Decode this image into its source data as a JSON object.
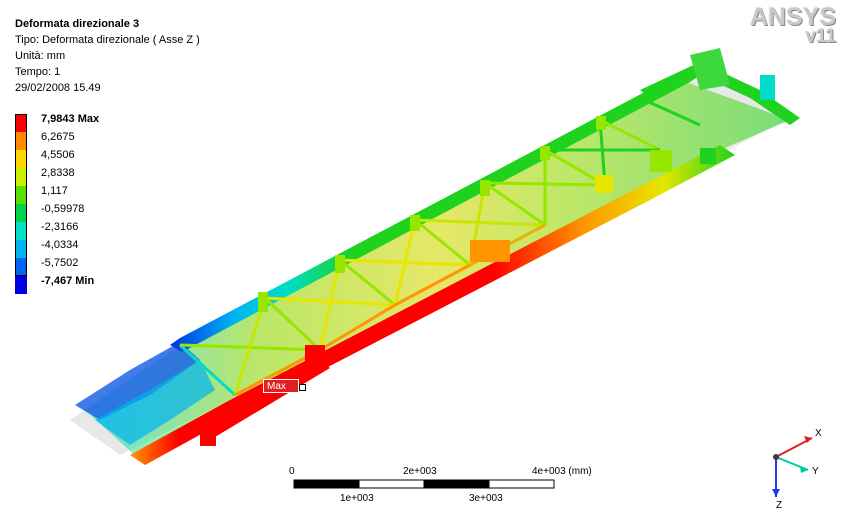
{
  "result": {
    "title": "Deformata direzionale 3",
    "type": "Tipo: Deformata direzionale ( Asse Z )",
    "unit": "Unità: mm",
    "time": "Tempo: 1",
    "date": "29/02/2008 15.49"
  },
  "legend": [
    {
      "label": "7,9843 Max",
      "color": "#ff0000",
      "bold": true
    },
    {
      "label": "6,2675",
      "color": "#ff8c00",
      "bold": false
    },
    {
      "label": "4,5506",
      "color": "#ffd700",
      "bold": false
    },
    {
      "label": "2,8338",
      "color": "#c8f000",
      "bold": false
    },
    {
      "label": "1,117",
      "color": "#5ae000",
      "bold": false
    },
    {
      "label": "-0,59978",
      "color": "#00d24a",
      "bold": false
    },
    {
      "label": "-2,3166",
      "color": "#00e2c8",
      "bold": false
    },
    {
      "label": "-4,0334",
      "color": "#00b4f0",
      "bold": false
    },
    {
      "label": "-5,7502",
      "color": "#0064f5",
      "bold": false
    },
    {
      "label": "-7,467 Min",
      "color": "#0000e0",
      "bold": true
    }
  ],
  "logo": {
    "name": "ANSYS",
    "version": "v11"
  },
  "max_marker": {
    "label": "Max"
  },
  "scale_bar": {
    "top_labels": [
      "0",
      "2e+003",
      "4e+003 (mm)"
    ],
    "bottom_labels": [
      "1e+003",
      "3e+003"
    ]
  },
  "triad": {
    "x": "X",
    "y": "Y",
    "z": "Z"
  },
  "colors": {
    "red": "#ff0000",
    "orange": "#ff9600",
    "yellow": "#e6e600",
    "lime": "#96e600",
    "green": "#1ed21e",
    "cyan": "#00dcc8",
    "blue": "#0032e6"
  }
}
